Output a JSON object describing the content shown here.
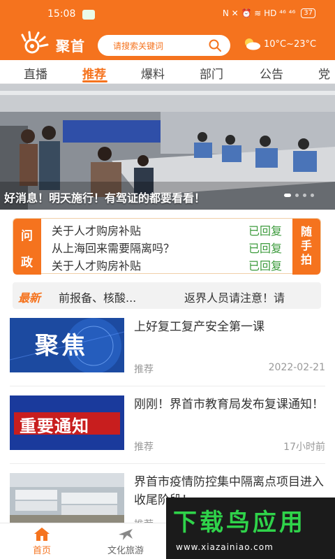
{
  "status_bar": {
    "time": "15:08",
    "indicators": "N ✕ ⏰ ≋ HD ⁴⁶ ⁴⁶",
    "battery": "37"
  },
  "header": {
    "app_name": "聚首",
    "search_placeholder": "请搜索关键词",
    "weather": "10°C~23°C"
  },
  "tabs": [
    {
      "label": "直播"
    },
    {
      "label": "推荐",
      "active": true
    },
    {
      "label": "爆料"
    },
    {
      "label": "部门"
    },
    {
      "label": "公告"
    },
    {
      "label": "党建"
    }
  ],
  "banner": {
    "caption": "好消息！明天施行！有驾证的都要看看！"
  },
  "qa": {
    "left_label": [
      "问",
      "政"
    ],
    "right_label": [
      "随",
      "手",
      "拍"
    ],
    "rows": [
      {
        "question": "关于人才购房补贴",
        "status": "已回复"
      },
      {
        "question": "从上海回来需要隔离吗？",
        "status": "已回复"
      },
      {
        "question": "关于人才购房补贴",
        "status": "已回复"
      }
    ]
  },
  "ticker": {
    "label": "最新",
    "items": [
      "前报备、核酸...",
      "返界人员请注意！请"
    ]
  },
  "news": [
    {
      "title": "上好复工复产安全第一课",
      "tag": "推荐",
      "time": "2022-02-21",
      "thumb_text": "聚焦"
    },
    {
      "title": "刚刚！界首市教育局发布复课通知！",
      "tag": "推荐",
      "time": "17小时前",
      "thumb_text": "重要通知"
    },
    {
      "title": "界首市疫情防控集中隔离点项目进入收尾阶段！",
      "tag": "推荐",
      "time": ""
    }
  ],
  "bottom_nav": [
    {
      "label": "首页",
      "active": true
    },
    {
      "label": "文化旅游"
    }
  ],
  "watermark": {
    "text": "下载鸟应用",
    "url": "www.xiazainiao.com"
  },
  "colors": {
    "accent": "#f5731e",
    "replied": "#3d9b3d",
    "watermark_green": "#2fd34a"
  }
}
